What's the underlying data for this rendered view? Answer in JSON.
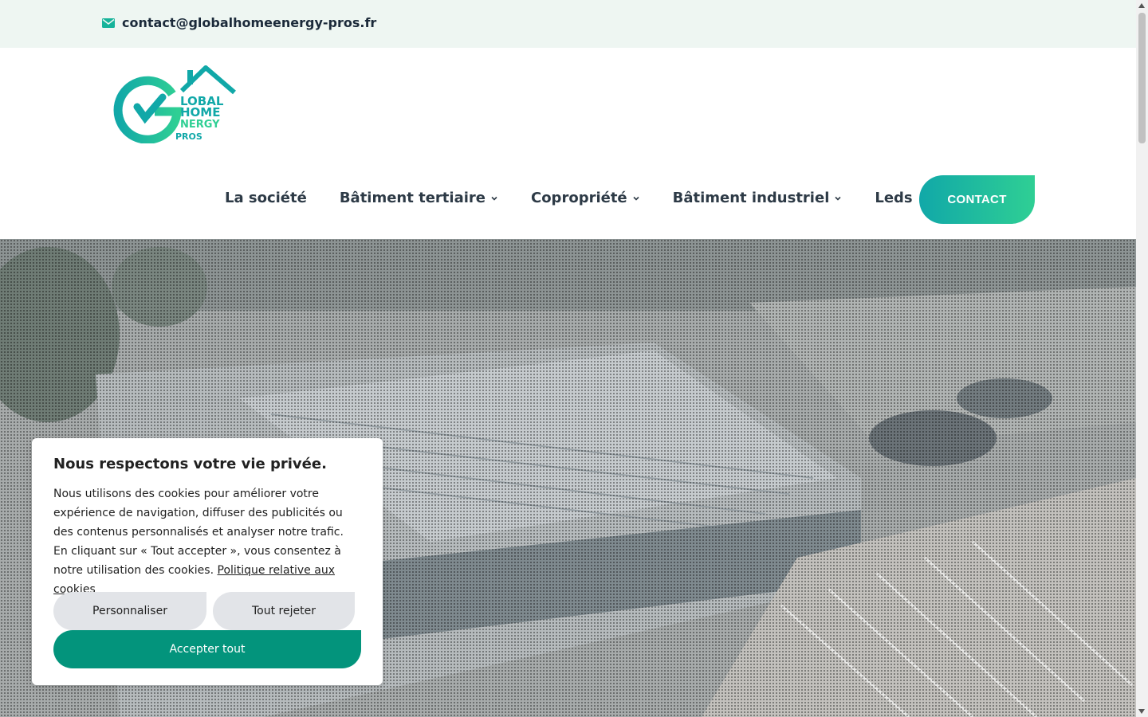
{
  "topbar": {
    "email": "contact@globalhomeenergy-pros.fr",
    "icon": "envelope-icon"
  },
  "logo": {
    "line1": "LOBAL",
    "line2": "HOME",
    "line3": "NERGY",
    "line4": "PROS",
    "color_teal": "#11a8a8",
    "color_green": "#2fcf94"
  },
  "nav": {
    "items": [
      {
        "label": "La société",
        "has_dropdown": false
      },
      {
        "label": "Bâtiment tertiaire",
        "has_dropdown": true
      },
      {
        "label": "Copropriété",
        "has_dropdown": true
      },
      {
        "label": "Bâtiment industriel",
        "has_dropdown": true
      },
      {
        "label": "Leds",
        "has_dropdown": false
      }
    ],
    "contact_label": "CONTACT"
  },
  "cookie": {
    "title": "Nous respectons votre vie privée.",
    "text": "Nous utilisons des cookies pour améliorer votre expérience de navigation, diffuser des publicités ou des contenus personnalisés et analyser notre trafic. En cliquant sur « Tout accepter », vous consentez à notre utilisation des cookies.",
    "policy_link": "Politique relative aux cookies",
    "customize_label": "Personnaliser",
    "reject_label": "Tout rejeter",
    "accept_label": "Accepter tout",
    "accept_color": "#03947c"
  }
}
